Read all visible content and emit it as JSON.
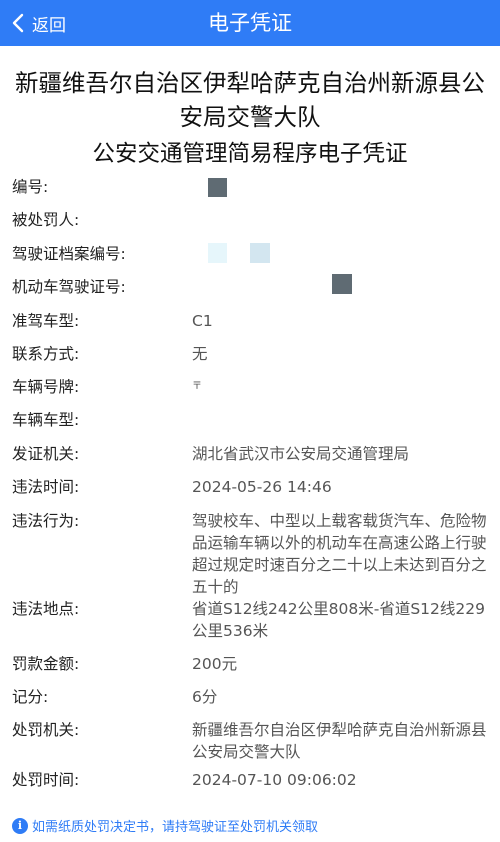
{
  "header": {
    "back_label": "返回",
    "title": "电子凭证"
  },
  "document": {
    "org_name": "新疆维吾尔自治区伊犁哈萨克自治州新源县公安局交警大队",
    "title": "公安交通管理简易程序电子凭证"
  },
  "fields": [
    {
      "label": "编号:",
      "value": ""
    },
    {
      "label": "被处罚人:",
      "value": ""
    },
    {
      "label": "驾驶证档案编号:",
      "value": ""
    },
    {
      "label": "机动车驾驶证号:",
      "value": ""
    },
    {
      "label": "准驾车型:",
      "value": "C1"
    },
    {
      "label": "联系方式:",
      "value": "无"
    },
    {
      "label": "车辆号牌:",
      "value": "〒"
    },
    {
      "label": "车辆车型:",
      "value": ""
    },
    {
      "label": "发证机关:",
      "value": "湖北省武汉市公安局交通管理局"
    },
    {
      "label": "违法时间:",
      "value": "2024-05-26 14:46"
    },
    {
      "label": "违法行为:",
      "value": "驾驶校车、中型以上载客载货汽车、危险物品运输车辆以外的机动车在高速公路上行驶超过规定时速百分之二十以上未达到百分之五十的"
    },
    {
      "label": "违法地点:",
      "value": "省道S12线242公里808米-省道S12线229公里536米"
    },
    {
      "label": "罚款金额:",
      "value": "200元"
    },
    {
      "label": "记分:",
      "value": "6分"
    },
    {
      "label": "处罚机关:",
      "value": "新疆维吾尔自治区伊犁哈萨克自治州新源县公安局交警大队"
    },
    {
      "label": "处罚时间:",
      "value": "2024-07-10 09:06:02"
    }
  ],
  "notice": {
    "icon": "info-icon",
    "text": "如需纸质处罚决定书，请持驾驶证至处罚机关领取"
  },
  "colors": {
    "accent": "#2f7cf6",
    "mosaic_dark": "#5f6b73",
    "mosaic_light1": "#e6f6fb",
    "mosaic_light2": "#d3e6f0"
  }
}
